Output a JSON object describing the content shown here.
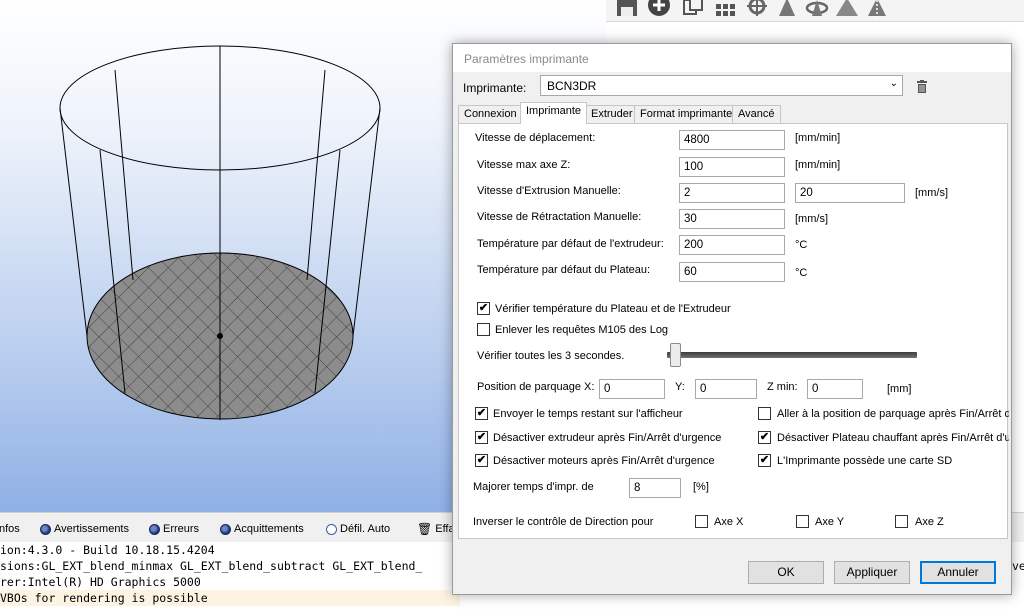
{
  "dialog": {
    "title": "Paramètres imprimante",
    "printer_label": "Imprimante:",
    "printer_value": "BCN3DR",
    "tabs": [
      "Connexion",
      "Imprimante",
      "Extruder",
      "Format imprimante",
      "Avancé"
    ],
    "active_tab": "Imprimante",
    "fields": {
      "travel_speed": {
        "label": "Vitesse de déplacement:",
        "value": "4800",
        "unit": "[mm/min]"
      },
      "z_speed": {
        "label": "Vitesse max axe Z:",
        "value": "100",
        "unit": "[mm/min]"
      },
      "manual_extrusion": {
        "label": "Vitesse d'Extrusion Manuelle:",
        "value1": "2",
        "value2": "20",
        "unit": "[mm/s]"
      },
      "manual_retraction": {
        "label": "Vitesse de Rétractation Manuelle:",
        "value": "30",
        "unit": "[mm/s]"
      },
      "extruder_temp": {
        "label": "Température par défaut de l'extrudeur:",
        "value": "200",
        "unit": "°C"
      },
      "bed_temp": {
        "label": "Température par défaut du Plateau:",
        "value": "60",
        "unit": "°C"
      }
    },
    "check_temp": {
      "label": "Vérifier température du Plateau et de l'Extrudeur",
      "checked": true
    },
    "remove_m105": {
      "label": "Enlever les requêtes M105 des Log",
      "checked": false
    },
    "check_interval_label": "Vérifier toutes les 3 secondes.",
    "park": {
      "label": "Position de parquage X:",
      "x": "0",
      "y_label": "Y:",
      "y": "0",
      "zmin_label": "Z min:",
      "zmin": "0",
      "unit": "[mm]"
    },
    "options": {
      "send_time": {
        "label": "Envoyer le temps restant sur l'afficheur",
        "checked": true
      },
      "goto_park": {
        "label": "Aller à la position de parquage après Fin/Arrêt d'u",
        "checked": false
      },
      "disable_extruder": {
        "label": "Désactiver extrudeur après Fin/Arrêt d'urgence",
        "checked": true
      },
      "disable_bed": {
        "label": "Désactiver Plateau chauffant après Fin/Arrêt d'urg",
        "checked": true
      },
      "disable_motors": {
        "label": "Désactiver moteurs après Fin/Arrêt d'urgence",
        "checked": true
      },
      "sd_card": {
        "label": "L'Imprimante possède une carte SD",
        "checked": true
      }
    },
    "print_time": {
      "label": "Majorer temps d'impr. de",
      "value": "8",
      "unit": "[%]"
    },
    "invert": {
      "label": "Inverser le contrôle de Direction pour",
      "x": "Axe X",
      "y": "Axe Y",
      "z": "Axe Z"
    },
    "buttons": {
      "ok": "OK",
      "apply": "Appliquer",
      "cancel": "Annuler"
    }
  },
  "log": {
    "filters": {
      "infos": "nfos",
      "warnings": "Avertissements",
      "errors": "Erreurs",
      "acks": "Acquittements",
      "autoscroll": "Défil. Auto",
      "clear": "Effac"
    },
    "lines": [
      "ion:4.3.0 - Build 10.18.15.4204",
      "sions:GL_EXT_blend_minmax GL_EXT_blend_subtract GL_EXT_blend_",
      "rer:Intel(R) HD Graphics 5000",
      "VBOs for rendering is possible"
    ],
    "right_clip": "ve"
  },
  "colors": {
    "accent": "#0078d7",
    "dialog_bg": "#f0f0f0",
    "bed_fill": "#8c8c8c",
    "log_line_bg": "#fdf3e2"
  }
}
